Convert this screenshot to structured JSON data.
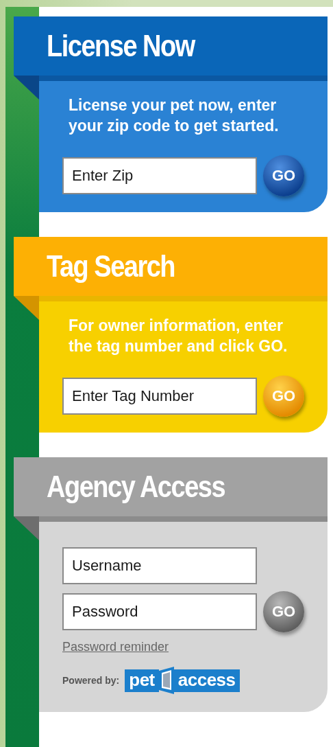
{
  "panels": [
    {
      "kind": "license",
      "color": "#0a66b8",
      "title": "License Now",
      "text": "License your pet now, enter your zip code to get started.",
      "fields": [
        {
          "placeholder": "Enter Zip"
        }
      ],
      "go_button": "GO"
    },
    {
      "kind": "search",
      "color": "#fdb004",
      "title": "Tag Search",
      "text": "For owner information, enter the tag number and click GO.",
      "fields": [
        {
          "placeholder": "Enter Tag Number"
        }
      ],
      "go_button": "GO"
    },
    {
      "kind": "login",
      "color": "#a2a2a2",
      "title": "Agency Access",
      "fields": [
        {
          "placeholder": "Username"
        },
        {
          "placeholder": "Password"
        }
      ],
      "go_button": "GO",
      "link": "Password reminder",
      "powered_by": {
        "label": "Powered by:",
        "logo_words": [
          "pet",
          "access"
        ]
      }
    }
  ]
}
